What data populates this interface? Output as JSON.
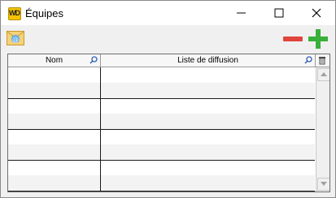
{
  "window": {
    "title": "Équipes",
    "app_icon": "windev-logo-icon",
    "app_icon_text": "WD"
  },
  "toolbar": {
    "mail_icon": "email-at-icon",
    "remove_icon": "minus-icon",
    "add_icon": "plus-icon",
    "colors": {
      "remove": "#e0443b",
      "add": "#39b039"
    }
  },
  "table": {
    "columns": [
      {
        "label": "Nom",
        "icon": "search-icon"
      },
      {
        "label": "Liste de diffusion",
        "icon": "search-icon"
      }
    ],
    "corner_icon": "delete-icon",
    "rows": [
      [
        "",
        ""
      ],
      [
        "",
        ""
      ],
      [
        "",
        ""
      ],
      [
        "",
        ""
      ],
      [
        "",
        ""
      ],
      [
        "",
        ""
      ],
      [
        "",
        ""
      ],
      [
        "",
        ""
      ]
    ]
  }
}
